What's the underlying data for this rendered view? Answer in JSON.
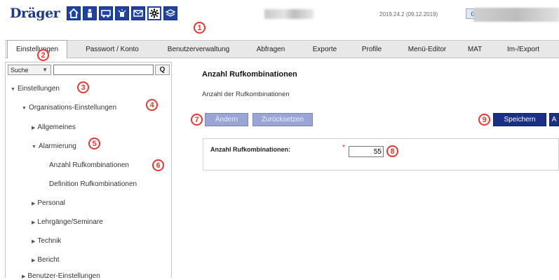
{
  "header": {
    "logo": "Dräger",
    "icons": [
      "home-icon",
      "person-icon",
      "vehicle-icon",
      "alarm-icon",
      "mail-icon",
      "gear-icon",
      "layers-icon"
    ],
    "version": "2019.24.2 (09.12.2019)",
    "count": "0"
  },
  "tabs": [
    "Einstellungen",
    "Passwort / Konto",
    "Benutzerverwaltung",
    "Abfragen",
    "Exporte",
    "Profile",
    "Menü-Editor",
    "MAT",
    "Im-/Export"
  ],
  "sidebar": {
    "search_select": "Suche",
    "search_value": "",
    "search_button": "Q",
    "tree": [
      "Einstellungen",
      "Organisations-Einstellungen",
      "Allgemeines",
      "Alarmierung",
      "Anzahl Rufkombinationen",
      "Definition Rufkombinationen",
      "Personal",
      "Lehrgänge/Seminare",
      "Technik",
      "Bericht",
      "Benutzer-Einstellungen"
    ]
  },
  "main": {
    "title": "Anzahl Rufkombinationen",
    "subtitle": "Anzahl der Rufkombinationen",
    "buttons": {
      "change": "Ändern",
      "reset": "Zurücksetzen",
      "save": "Speichern",
      "extra": "A"
    },
    "field": {
      "label": "Anzahl Rufkombinationen:",
      "required": "*",
      "value": "55"
    }
  },
  "callouts": [
    "1",
    "2",
    "3",
    "4",
    "5",
    "6",
    "7",
    "8",
    "9"
  ],
  "colors": {
    "brand": "#1f43a4",
    "primary_button": "#1a2f86",
    "disabled_button": "#9aa5d3",
    "callout": "#e53935"
  }
}
